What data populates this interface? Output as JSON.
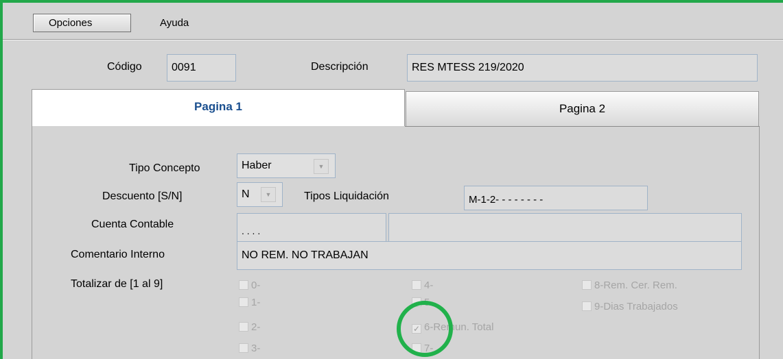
{
  "menu": {
    "opciones": "Opciones",
    "ayuda": "Ayuda"
  },
  "header": {
    "codigo_label": "Código",
    "codigo_value": "0091",
    "descripcion_label": "Descripción",
    "descripcion_value": "RES MTESS 219/2020"
  },
  "tabs": [
    {
      "label": "Pagina 1",
      "active": true
    },
    {
      "label": "Pagina 2",
      "active": false
    }
  ],
  "form": {
    "tipo_concepto_label": "Tipo Concepto",
    "tipo_concepto_value": "Haber",
    "descuento_label": "Descuento [S/N]",
    "descuento_value": "N",
    "tipos_liq_label": "Tipos Liquidación",
    "tipos_liq_value": "M-1-2- - - - - - - -",
    "cuenta_label": "Cuenta Contable",
    "cuenta_value": ". . . .",
    "cuenta_desc_value": "",
    "comentario_label": "Comentario Interno",
    "comentario_value": "NO REM. NO TRABAJAN",
    "totalizar_label": "Totalizar de [1 al  9]"
  },
  "checkboxes": [
    {
      "label": "0-",
      "checked": false
    },
    {
      "label": "1-",
      "checked": false
    },
    {
      "label": "2-",
      "checked": false
    },
    {
      "label": "3-",
      "checked": false
    },
    {
      "label": "4-",
      "checked": false
    },
    {
      "label": "5-",
      "checked": false
    },
    {
      "label": "6-Remun. Total",
      "checked": true
    },
    {
      "label": "7-",
      "checked": false
    },
    {
      "label": "8-Rem. Cer. Rem.",
      "checked": false
    },
    {
      "label": "9-Dias Trabajados",
      "checked": false
    }
  ],
  "icons": {
    "dropdown": "chevron-down-icon",
    "check": "check-icon"
  },
  "colors": {
    "annotation": "#21b14b",
    "tab_active_text": "#1a4f8f"
  }
}
